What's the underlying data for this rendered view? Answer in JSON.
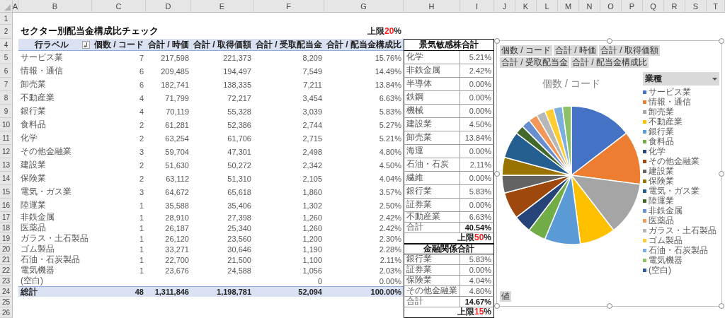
{
  "sheet": {
    "columns": [
      "A",
      "B",
      "C",
      "D",
      "E",
      "F",
      "G",
      "H",
      "I",
      "J",
      "K",
      "L",
      "M",
      "N",
      "O",
      "P",
      "Q",
      "R",
      "S",
      "T"
    ],
    "rows": [
      "1",
      "2",
      "4",
      "5",
      "6",
      "7",
      "8",
      "9",
      "10",
      "11",
      "12",
      "13",
      "14",
      "15",
      "16",
      "17",
      "18",
      "19",
      "20",
      "21",
      "22",
      "23",
      "24",
      "25",
      "26"
    ]
  },
  "title": "セクター別配当金構成比チェック",
  "main_limit": {
    "label": "上限",
    "value": "20",
    "unit": "%"
  },
  "pivot": {
    "columns": [
      "行ラベル",
      "個数 / コード",
      "合計 / 時価",
      "合計 / 取得価額",
      "合計 / 受取配当金",
      "合計 / 配当金構成比"
    ],
    "rows": [
      {
        "cells": [
          "サービス業",
          "7",
          "217,598",
          "221,373",
          "8,209",
          "15.76%"
        ]
      },
      {
        "cells": [
          "情報・通信",
          "6",
          "209,485",
          "194,497",
          "7,549",
          "14.49%"
        ]
      },
      {
        "cells": [
          "卸売業",
          "6",
          "182,741",
          "138,335",
          "7,211",
          "13.84%"
        ]
      },
      {
        "cells": [
          "不動産業",
          "4",
          "71,799",
          "72,217",
          "3,454",
          "6.63%"
        ]
      },
      {
        "cells": [
          "銀行業",
          "4",
          "70,119",
          "55,328",
          "3,039",
          "5.83%"
        ]
      },
      {
        "cells": [
          "食料品",
          "2",
          "61,281",
          "52,386",
          "2,744",
          "5.27%"
        ]
      },
      {
        "cells": [
          "化学",
          "2",
          "63,254",
          "61,706",
          "2,715",
          "5.21%"
        ]
      },
      {
        "cells": [
          "その他金融業",
          "3",
          "59,704",
          "47,301",
          "2,498",
          "4.80%"
        ]
      },
      {
        "cells": [
          "建設業",
          "2",
          "51,630",
          "50,272",
          "2,342",
          "4.50%"
        ]
      },
      {
        "cells": [
          "保険業",
          "2",
          "63,112",
          "51,310",
          "2,105",
          "4.04%"
        ]
      },
      {
        "cells": [
          "電気・ガス業",
          "3",
          "64,672",
          "65,618",
          "1,860",
          "3.57%"
        ]
      },
      {
        "cells": [
          "陸運業",
          "1",
          "35,588",
          "35,406",
          "1,302",
          "2.50%"
        ]
      },
      {
        "cells": [
          "非鉄金属",
          "1",
          "28,910",
          "27,398",
          "1,260",
          "2.42%"
        ]
      },
      {
        "cells": [
          "医薬品",
          "1",
          "26,187",
          "25,340",
          "1,260",
          "2.42%"
        ]
      },
      {
        "cells": [
          "ガラス・土石製品",
          "1",
          "26,120",
          "23,560",
          "1,200",
          "2.30%"
        ]
      },
      {
        "cells": [
          "ゴム製品",
          "1",
          "33,271",
          "30,646",
          "1,190",
          "2.28%"
        ]
      },
      {
        "cells": [
          "石油・石炭製品",
          "1",
          "22,700",
          "21,500",
          "1,100",
          "2.11%"
        ]
      },
      {
        "cells": [
          "電気機器",
          "1",
          "23,676",
          "24,588",
          "1,056",
          "2.03%"
        ]
      },
      {
        "cells": [
          "(空白)",
          null,
          null,
          null,
          "0",
          "0.00%"
        ]
      }
    ],
    "total": {
      "cells": [
        "総計",
        "48",
        "1,311,846",
        "1,198,781",
        "52,094",
        "100.00%"
      ]
    }
  },
  "summaries": [
    {
      "title": "景気敏感株合計",
      "items": [
        {
          "label": "化学",
          "value": "5.21%"
        },
        {
          "label": "非鉄金属",
          "value": "2.42%"
        },
        {
          "label": "半導体",
          "value": "0.00%"
        },
        {
          "label": "鉄鋼",
          "value": "0.00%"
        },
        {
          "label": "機械",
          "value": "0.00%"
        },
        {
          "label": "建設業",
          "value": "4.50%"
        },
        {
          "label": "卸売業",
          "value": "13.84%"
        },
        {
          "label": "海運",
          "value": "0.00%"
        },
        {
          "label": "石油・石炭",
          "value": "2.11%"
        },
        {
          "label": "繊維",
          "value": "0.00%"
        },
        {
          "label": "銀行業",
          "value": "5.83%"
        },
        {
          "label": "証券業",
          "value": "0.00%"
        },
        {
          "label": "不動産業",
          "value": "6.63%"
        }
      ],
      "total": {
        "label": "合計",
        "value": "40.54%"
      },
      "limit": {
        "label": "上限",
        "value": "50",
        "unit": "%"
      }
    },
    {
      "title": "金融関係合計",
      "items": [
        {
          "label": "銀行業",
          "value": "5.83%"
        },
        {
          "label": "証券業",
          "value": "0.00%"
        },
        {
          "label": "保険業",
          "value": "4.04%"
        },
        {
          "label": "その他金融業",
          "value": "4.80%"
        }
      ],
      "total": {
        "label": "合計",
        "value": "14.67%"
      },
      "limit": {
        "label": "上限",
        "value": "15",
        "unit": "%"
      }
    }
  ],
  "chart": {
    "field_buttons": [
      "個数 / コード",
      "合計 / 時価",
      "合計 / 取得価額",
      "合計 / 受取配当金",
      "合計 / 配当金構成比"
    ],
    "legend_field": "業種",
    "value_button": "値",
    "chart_data": {
      "type": "pie",
      "title": "個数 / コード",
      "categories": [
        "サービス業",
        "情報・通信",
        "卸売業",
        "不動産業",
        "銀行業",
        "食料品",
        "化学",
        "その他金融業",
        "建設業",
        "保険業",
        "電気・ガス業",
        "陸運業",
        "非鉄金属",
        "医薬品",
        "ガラス・土石製品",
        "ゴム製品",
        "石油・石炭製品",
        "電気機器",
        "(空白)"
      ],
      "values": [
        14.58,
        12.5,
        12.5,
        8.33,
        8.33,
        4.17,
        4.17,
        6.25,
        4.17,
        4.17,
        6.25,
        2.08,
        2.08,
        2.08,
        2.08,
        2.08,
        2.08,
        2.08,
        0
      ],
      "colors": [
        "#4472c4",
        "#ed7d31",
        "#a5a5a5",
        "#ffc000",
        "#5b9bd5",
        "#70ad47",
        "#264478",
        "#9e480e",
        "#636363",
        "#997300",
        "#255e91",
        "#43682b",
        "#698ed0",
        "#f1975a",
        "#b7b7b7",
        "#ffcd33",
        "#7cafdd",
        "#8cc168",
        "#335aa1"
      ]
    }
  }
}
